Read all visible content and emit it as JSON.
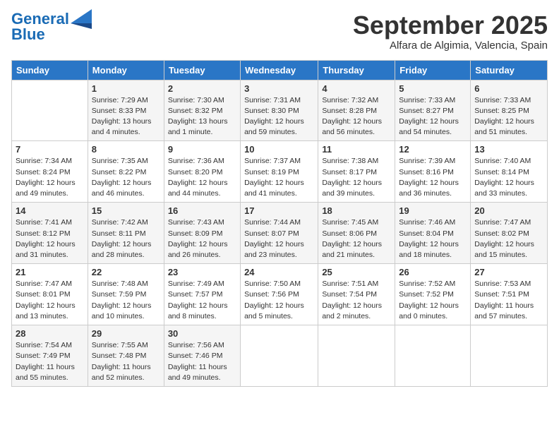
{
  "logo": {
    "line1": "General",
    "line2": "Blue"
  },
  "title": "September 2025",
  "location": "Alfara de Algimia, Valencia, Spain",
  "days_of_week": [
    "Sunday",
    "Monday",
    "Tuesday",
    "Wednesday",
    "Thursday",
    "Friday",
    "Saturday"
  ],
  "weeks": [
    [
      {
        "day": "",
        "info": ""
      },
      {
        "day": "1",
        "info": "Sunrise: 7:29 AM\nSunset: 8:33 PM\nDaylight: 13 hours\nand 4 minutes."
      },
      {
        "day": "2",
        "info": "Sunrise: 7:30 AM\nSunset: 8:32 PM\nDaylight: 13 hours\nand 1 minute."
      },
      {
        "day": "3",
        "info": "Sunrise: 7:31 AM\nSunset: 8:30 PM\nDaylight: 12 hours\nand 59 minutes."
      },
      {
        "day": "4",
        "info": "Sunrise: 7:32 AM\nSunset: 8:28 PM\nDaylight: 12 hours\nand 56 minutes."
      },
      {
        "day": "5",
        "info": "Sunrise: 7:33 AM\nSunset: 8:27 PM\nDaylight: 12 hours\nand 54 minutes."
      },
      {
        "day": "6",
        "info": "Sunrise: 7:33 AM\nSunset: 8:25 PM\nDaylight: 12 hours\nand 51 minutes."
      }
    ],
    [
      {
        "day": "7",
        "info": "Sunrise: 7:34 AM\nSunset: 8:24 PM\nDaylight: 12 hours\nand 49 minutes."
      },
      {
        "day": "8",
        "info": "Sunrise: 7:35 AM\nSunset: 8:22 PM\nDaylight: 12 hours\nand 46 minutes."
      },
      {
        "day": "9",
        "info": "Sunrise: 7:36 AM\nSunset: 8:20 PM\nDaylight: 12 hours\nand 44 minutes."
      },
      {
        "day": "10",
        "info": "Sunrise: 7:37 AM\nSunset: 8:19 PM\nDaylight: 12 hours\nand 41 minutes."
      },
      {
        "day": "11",
        "info": "Sunrise: 7:38 AM\nSunset: 8:17 PM\nDaylight: 12 hours\nand 39 minutes."
      },
      {
        "day": "12",
        "info": "Sunrise: 7:39 AM\nSunset: 8:16 PM\nDaylight: 12 hours\nand 36 minutes."
      },
      {
        "day": "13",
        "info": "Sunrise: 7:40 AM\nSunset: 8:14 PM\nDaylight: 12 hours\nand 33 minutes."
      }
    ],
    [
      {
        "day": "14",
        "info": "Sunrise: 7:41 AM\nSunset: 8:12 PM\nDaylight: 12 hours\nand 31 minutes."
      },
      {
        "day": "15",
        "info": "Sunrise: 7:42 AM\nSunset: 8:11 PM\nDaylight: 12 hours\nand 28 minutes."
      },
      {
        "day": "16",
        "info": "Sunrise: 7:43 AM\nSunset: 8:09 PM\nDaylight: 12 hours\nand 26 minutes."
      },
      {
        "day": "17",
        "info": "Sunrise: 7:44 AM\nSunset: 8:07 PM\nDaylight: 12 hours\nand 23 minutes."
      },
      {
        "day": "18",
        "info": "Sunrise: 7:45 AM\nSunset: 8:06 PM\nDaylight: 12 hours\nand 21 minutes."
      },
      {
        "day": "19",
        "info": "Sunrise: 7:46 AM\nSunset: 8:04 PM\nDaylight: 12 hours\nand 18 minutes."
      },
      {
        "day": "20",
        "info": "Sunrise: 7:47 AM\nSunset: 8:02 PM\nDaylight: 12 hours\nand 15 minutes."
      }
    ],
    [
      {
        "day": "21",
        "info": "Sunrise: 7:47 AM\nSunset: 8:01 PM\nDaylight: 12 hours\nand 13 minutes."
      },
      {
        "day": "22",
        "info": "Sunrise: 7:48 AM\nSunset: 7:59 PM\nDaylight: 12 hours\nand 10 minutes."
      },
      {
        "day": "23",
        "info": "Sunrise: 7:49 AM\nSunset: 7:57 PM\nDaylight: 12 hours\nand 8 minutes."
      },
      {
        "day": "24",
        "info": "Sunrise: 7:50 AM\nSunset: 7:56 PM\nDaylight: 12 hours\nand 5 minutes."
      },
      {
        "day": "25",
        "info": "Sunrise: 7:51 AM\nSunset: 7:54 PM\nDaylight: 12 hours\nand 2 minutes."
      },
      {
        "day": "26",
        "info": "Sunrise: 7:52 AM\nSunset: 7:52 PM\nDaylight: 12 hours\nand 0 minutes."
      },
      {
        "day": "27",
        "info": "Sunrise: 7:53 AM\nSunset: 7:51 PM\nDaylight: 11 hours\nand 57 minutes."
      }
    ],
    [
      {
        "day": "28",
        "info": "Sunrise: 7:54 AM\nSunset: 7:49 PM\nDaylight: 11 hours\nand 55 minutes."
      },
      {
        "day": "29",
        "info": "Sunrise: 7:55 AM\nSunset: 7:48 PM\nDaylight: 11 hours\nand 52 minutes."
      },
      {
        "day": "30",
        "info": "Sunrise: 7:56 AM\nSunset: 7:46 PM\nDaylight: 11 hours\nand 49 minutes."
      },
      {
        "day": "",
        "info": ""
      },
      {
        "day": "",
        "info": ""
      },
      {
        "day": "",
        "info": ""
      },
      {
        "day": "",
        "info": ""
      }
    ]
  ]
}
